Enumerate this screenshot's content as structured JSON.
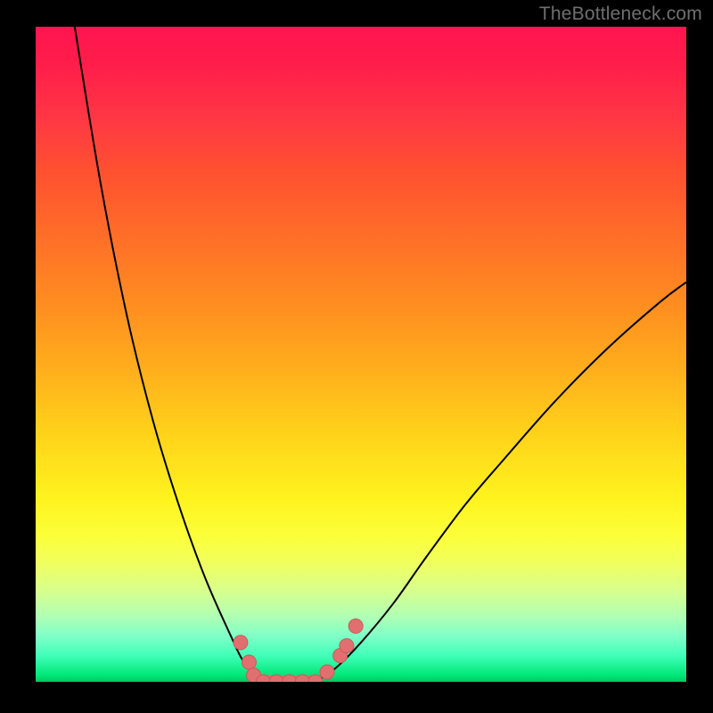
{
  "watermark": "TheBottleneck.com",
  "colors": {
    "background": "#000000",
    "curve_stroke": "#000000",
    "marker_fill": "#e26f6f",
    "marker_stroke": "#c85a5a"
  },
  "chart_data": {
    "type": "line",
    "title": "",
    "xlabel": "",
    "ylabel": "",
    "xlim": [
      0,
      100
    ],
    "ylim": [
      0,
      100
    ],
    "series": [
      {
        "name": "bottleneck-curve-left",
        "x": [
          6,
          10,
          14,
          18,
          22,
          26,
          30,
          32,
          34,
          35
        ],
        "values": [
          100,
          76,
          56,
          40,
          27,
          16,
          7,
          3,
          1,
          0
        ]
      },
      {
        "name": "bottleneck-curve-right",
        "x": [
          43,
          46,
          50,
          55,
          60,
          66,
          72,
          80,
          88,
          96,
          100
        ],
        "values": [
          0,
          2,
          6,
          12,
          19,
          27,
          34,
          43,
          51,
          58,
          61
        ]
      },
      {
        "name": "optimal-flat",
        "x": [
          35,
          43
        ],
        "values": [
          0,
          0
        ]
      }
    ],
    "markers": [
      {
        "x": 31.5,
        "y": 6.0
      },
      {
        "x": 32.8,
        "y": 3.0
      },
      {
        "x": 33.5,
        "y": 1.0
      },
      {
        "x": 35.0,
        "y": 0.0
      },
      {
        "x": 37.0,
        "y": 0.0
      },
      {
        "x": 39.0,
        "y": 0.0
      },
      {
        "x": 41.0,
        "y": 0.0
      },
      {
        "x": 43.0,
        "y": 0.0
      },
      {
        "x": 44.8,
        "y": 1.5
      },
      {
        "x": 46.8,
        "y": 4.0
      },
      {
        "x": 47.8,
        "y": 5.5
      },
      {
        "x": 49.2,
        "y": 8.5
      }
    ],
    "gradient_stops": [
      {
        "pos": 0,
        "color": "#ff1450"
      },
      {
        "pos": 50,
        "color": "#ffc81c"
      },
      {
        "pos": 78,
        "color": "#fcff30"
      },
      {
        "pos": 100,
        "color": "#00d068"
      }
    ]
  }
}
